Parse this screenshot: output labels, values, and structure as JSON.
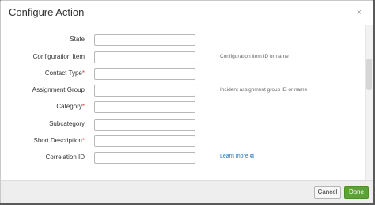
{
  "dialog": {
    "title": "Configure Action",
    "close_glyph": "×"
  },
  "fields": [
    {
      "label": "State",
      "required": false,
      "value": "",
      "help": ""
    },
    {
      "label": "Configuration Item",
      "required": false,
      "value": "",
      "help": "Configuration item ID or name"
    },
    {
      "label": "Contact Type",
      "required": true,
      "value": "",
      "help": ""
    },
    {
      "label": "Assignment Group",
      "required": false,
      "value": "",
      "help": "Incident assignment group ID or name"
    },
    {
      "label": "Category",
      "required": true,
      "value": "",
      "help": ""
    },
    {
      "label": "Subcategory",
      "required": false,
      "value": "",
      "help": ""
    },
    {
      "label": "Short Description",
      "required": true,
      "value": "",
      "help": ""
    },
    {
      "label": "Correlation ID",
      "required": false,
      "value": "",
      "help": ""
    }
  ],
  "required_marker": "*",
  "learn_more": {
    "text": "Learn more",
    "icon": "external-link-icon",
    "glyph": "⧉"
  },
  "footer": {
    "cancel_label": "Cancel",
    "done_label": "Done"
  },
  "colors": {
    "accent_done": "#5ca335",
    "required_marker": "#d6413b",
    "link": "#1a6fb4"
  }
}
